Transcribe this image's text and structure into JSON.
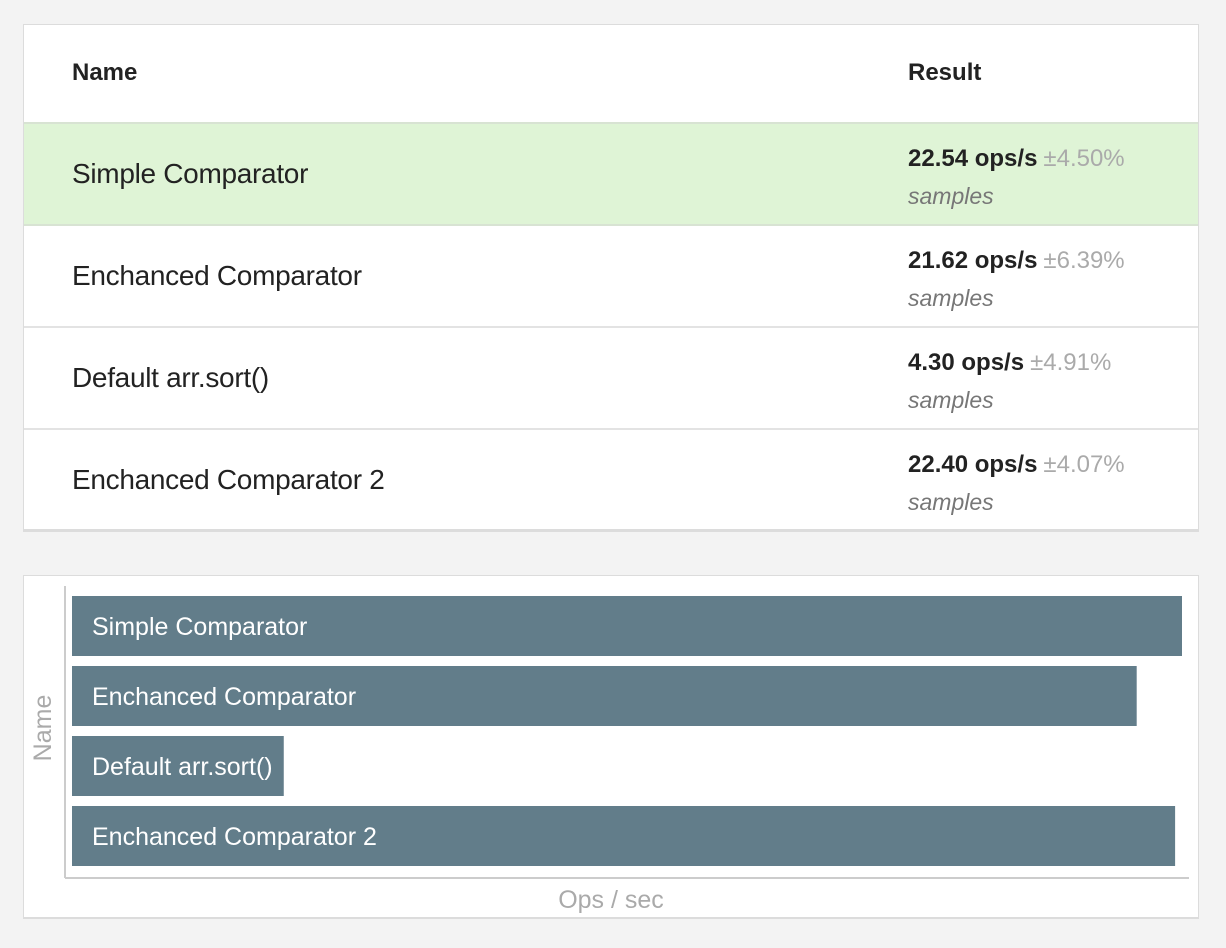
{
  "table": {
    "headers": {
      "name": "Name",
      "result": "Result"
    },
    "rows": [
      {
        "name": "Simple Comparator",
        "ops": "22.54 ops/s",
        "error": "±4.50%",
        "samples": "samples",
        "fastest": true
      },
      {
        "name": "Enchanced Comparator",
        "ops": "21.62 ops/s",
        "error": "±6.39%",
        "samples": "samples",
        "fastest": false
      },
      {
        "name": "Default arr.sort()",
        "ops": "4.30 ops/s",
        "error": "±4.91%",
        "samples": "samples",
        "fastest": false
      },
      {
        "name": "Enchanced Comparator 2",
        "ops": "22.40 ops/s",
        "error": "±4.07%",
        "samples": "samples",
        "fastest": false
      }
    ]
  },
  "chart_data": {
    "type": "bar",
    "orientation": "horizontal",
    "categories": [
      "Simple Comparator",
      "Enchanced Comparator",
      "Default arr.sort()",
      "Enchanced Comparator 2"
    ],
    "values": [
      22.54,
      21.62,
      4.3,
      22.4
    ],
    "xlabel": "Ops / sec",
    "ylabel": "Name",
    "xlim": [
      0,
      22.54
    ],
    "grid": false,
    "bar_color": "#627d8a"
  }
}
